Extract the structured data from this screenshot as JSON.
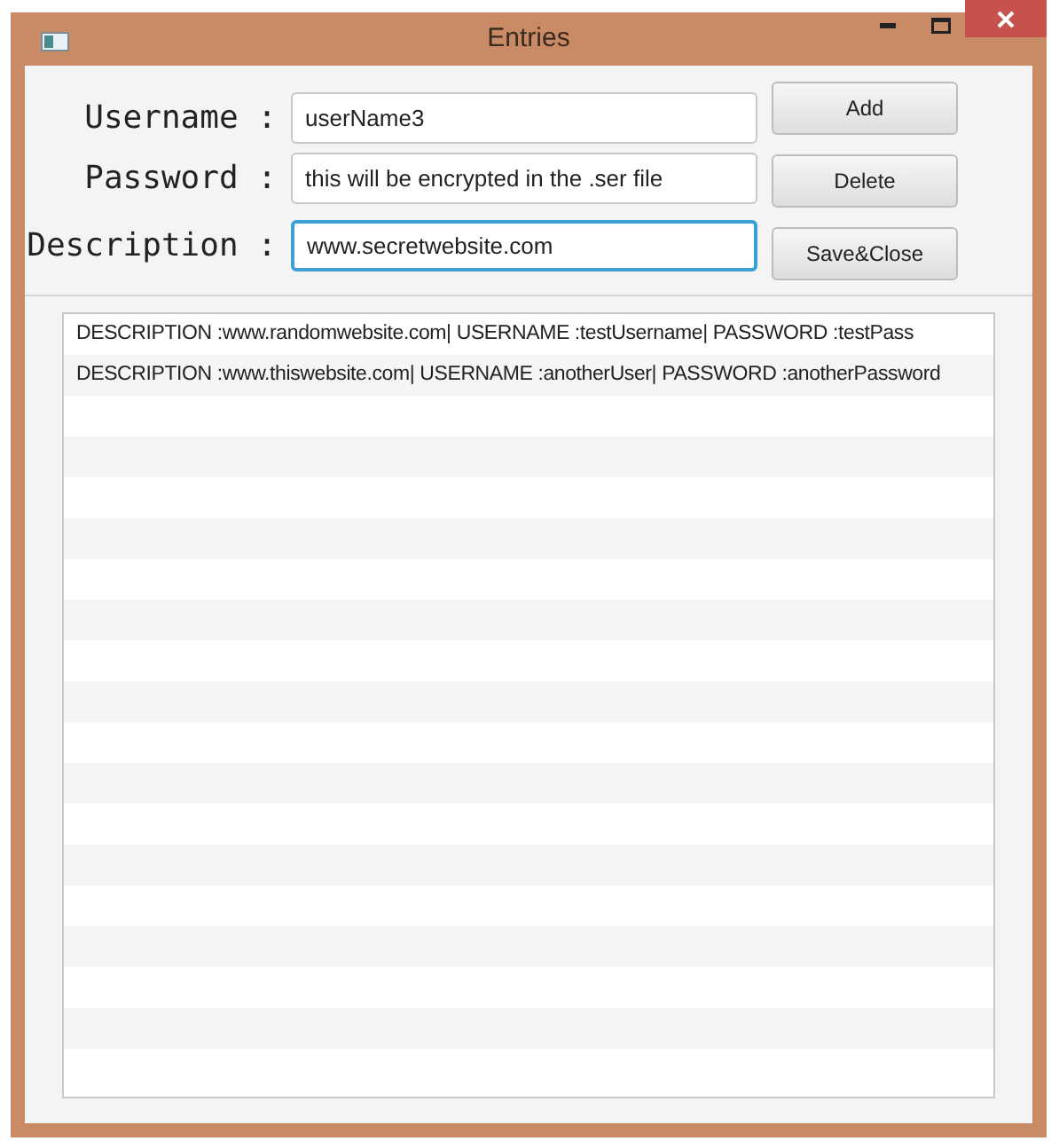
{
  "window": {
    "title": "Entries"
  },
  "fields": [
    {
      "label": "Username :",
      "value": "userName3",
      "focused": false
    },
    {
      "label": "Password :",
      "value": "this will be encrypted in the .ser file",
      "focused": false
    },
    {
      "label": "Description :",
      "value": "www.secretwebsite.com",
      "focused": true
    }
  ],
  "buttons": [
    "Add",
    "Delete",
    "Save&Close"
  ],
  "entries": [
    "DESCRIPTION :www.randomwebsite.com| USERNAME :testUsername| PASSWORD :testPass",
    "DESCRIPTION :www.thiswebsite.com| USERNAME :anotherUser| PASSWORD :anotherPassword"
  ]
}
